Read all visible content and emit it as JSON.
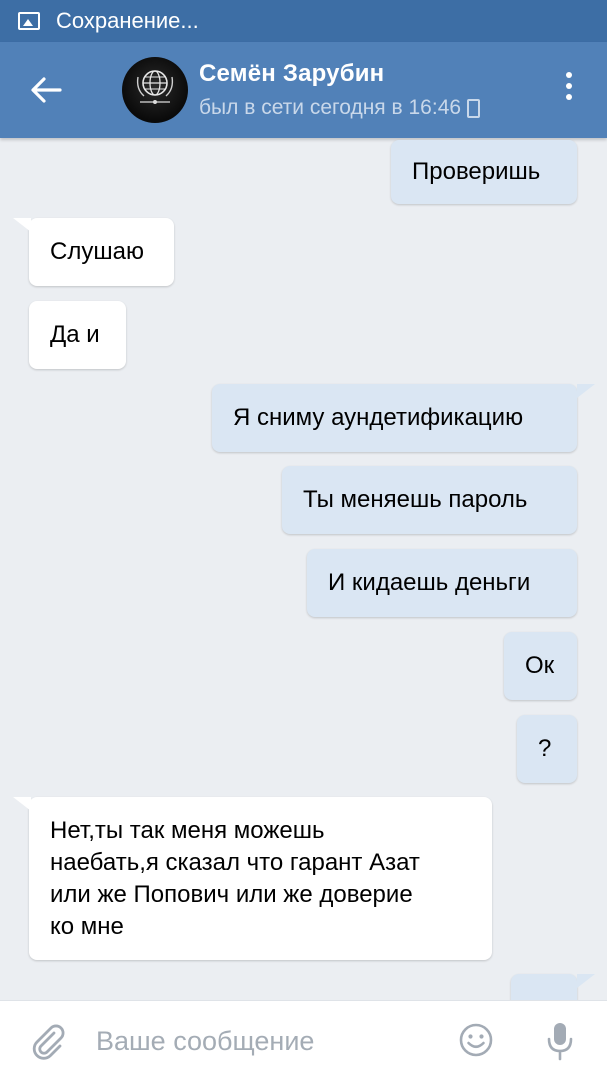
{
  "status_bar": {
    "text": "Сохранение...",
    "icon": "image-icon"
  },
  "header": {
    "contact_name": "Семён Зарубин",
    "contact_status": "был в сети сегодня в 16:46",
    "status_device_icon": "phone-icon",
    "back_icon": "arrow-left-icon",
    "menu_icon": "more-vertical-icon"
  },
  "messages": [
    {
      "direction": "out",
      "text": "Проверишь"
    },
    {
      "direction": "in",
      "text": "Слушаю"
    },
    {
      "direction": "in",
      "text": "Да и"
    },
    {
      "direction": "out",
      "text": "Я сниму аундетификацию"
    },
    {
      "direction": "out",
      "text": "Ты меняешь пароль"
    },
    {
      "direction": "out",
      "text": "И кидаешь деньги"
    },
    {
      "direction": "out",
      "text": "Ок"
    },
    {
      "direction": "out",
      "text": "?"
    },
    {
      "direction": "in",
      "lines": [
        "Нет,ты так меня можешь",
        "наебать,я сказал что гарант Азат",
        "или же Попович или же доверие",
        "ко мне"
      ]
    }
  ],
  "input": {
    "placeholder": "Ваше сообщение",
    "value": ""
  },
  "icons": {
    "attach": "paperclip-icon",
    "emoji": "smiley-icon",
    "voice": "microphone-icon"
  },
  "colors": {
    "header": "#5181b8",
    "status_bar": "#3d6ea5",
    "outgoing_bubble": "#dae6f3",
    "incoming_bubble": "#ffffff",
    "chat_background": "#ebeef2"
  }
}
